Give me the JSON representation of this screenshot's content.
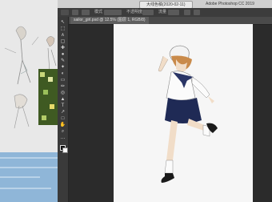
{
  "window": {
    "doc_tab_title": "大线色稿(2020-02-11)",
    "app_title": "Adobe Photoshop CC 2019"
  },
  "options_bar": {
    "mode_label": "模式",
    "opacity_label": "不透明度",
    "flow_label": "流量"
  },
  "document": {
    "tab_label": "sailor_girl.psd @ 12.5% (图层 1, RGB/8)"
  },
  "toolbar": {
    "tools": [
      "↖",
      "⬚",
      "∧",
      "▢",
      "✚",
      "●",
      "✎",
      "✦",
      "◐",
      "▭",
      "✏",
      "◎",
      "▲",
      "T",
      "↗",
      "□",
      "✋",
      "⌕",
      "…"
    ]
  },
  "colors": {
    "workspace": "#2b2b2b",
    "canvas": "#f6f6f6",
    "toolbar": "#3a3a3a",
    "skirt_navy": "#1f2a55",
    "hair_orange": "#c98a4a"
  },
  "icons": {
    "foreground_color": "foreground-swatch-icon",
    "background_color": "background-swatch-icon"
  }
}
